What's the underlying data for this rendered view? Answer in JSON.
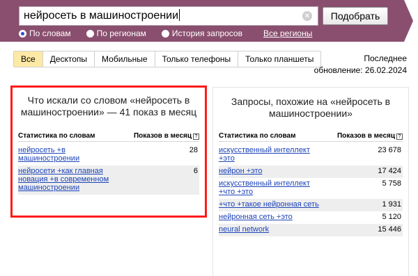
{
  "search": {
    "query": "нейросеть в машиностроении",
    "clear_icon": "×",
    "submit_label": "Подобрать"
  },
  "modes": [
    {
      "label": "По словам",
      "checked": true
    },
    {
      "label": "По регионам",
      "checked": false
    },
    {
      "label": "История запросов",
      "checked": false
    }
  ],
  "regions_link": "Все регионы",
  "tabs": [
    {
      "label": "Все",
      "active": true
    },
    {
      "label": "Десктопы",
      "active": false
    },
    {
      "label": "Мобильные",
      "active": false
    },
    {
      "label": "Только телефоны",
      "active": false
    },
    {
      "label": "Только планшеты",
      "active": false
    }
  ],
  "update": {
    "line1": "Последнее",
    "line2": "обновление: 26.02.2024"
  },
  "left_panel": {
    "title": "Что искали со словом «нейросеть в машиностроении» — 41 показ в месяц",
    "col_words": "Статистика по словам",
    "col_shows": "Показов в месяц",
    "help_icon": "?",
    "rows": [
      {
        "query": "нейросеть +в машиностроении",
        "count": "28"
      },
      {
        "query": "нейросети +как главная новация +в современном машиностроении",
        "count": "6"
      }
    ]
  },
  "right_panel": {
    "title": "Запросы, похожие на «нейросеть в машиностроении»",
    "col_words": "Статистика по словам",
    "col_shows": "Показов в месяц",
    "help_icon": "?",
    "rows": [
      {
        "query": "искусственный интеллект +это",
        "count": "23 678"
      },
      {
        "query": "нейрон +это",
        "count": "17 424"
      },
      {
        "query": "искусственный интеллект +что +это",
        "count": "5 758"
      },
      {
        "query": "+что +такое нейронная сеть",
        "count": "1 931"
      },
      {
        "query": "нейронная сеть +это",
        "count": "5 120"
      },
      {
        "query": "neural network",
        "count": "15 446"
      }
    ]
  },
  "colors": {
    "header": "#8a4f6e",
    "highlight_border": "#ff1a1a",
    "active_tab": "#fde9a6",
    "link": "#1d44b8"
  }
}
